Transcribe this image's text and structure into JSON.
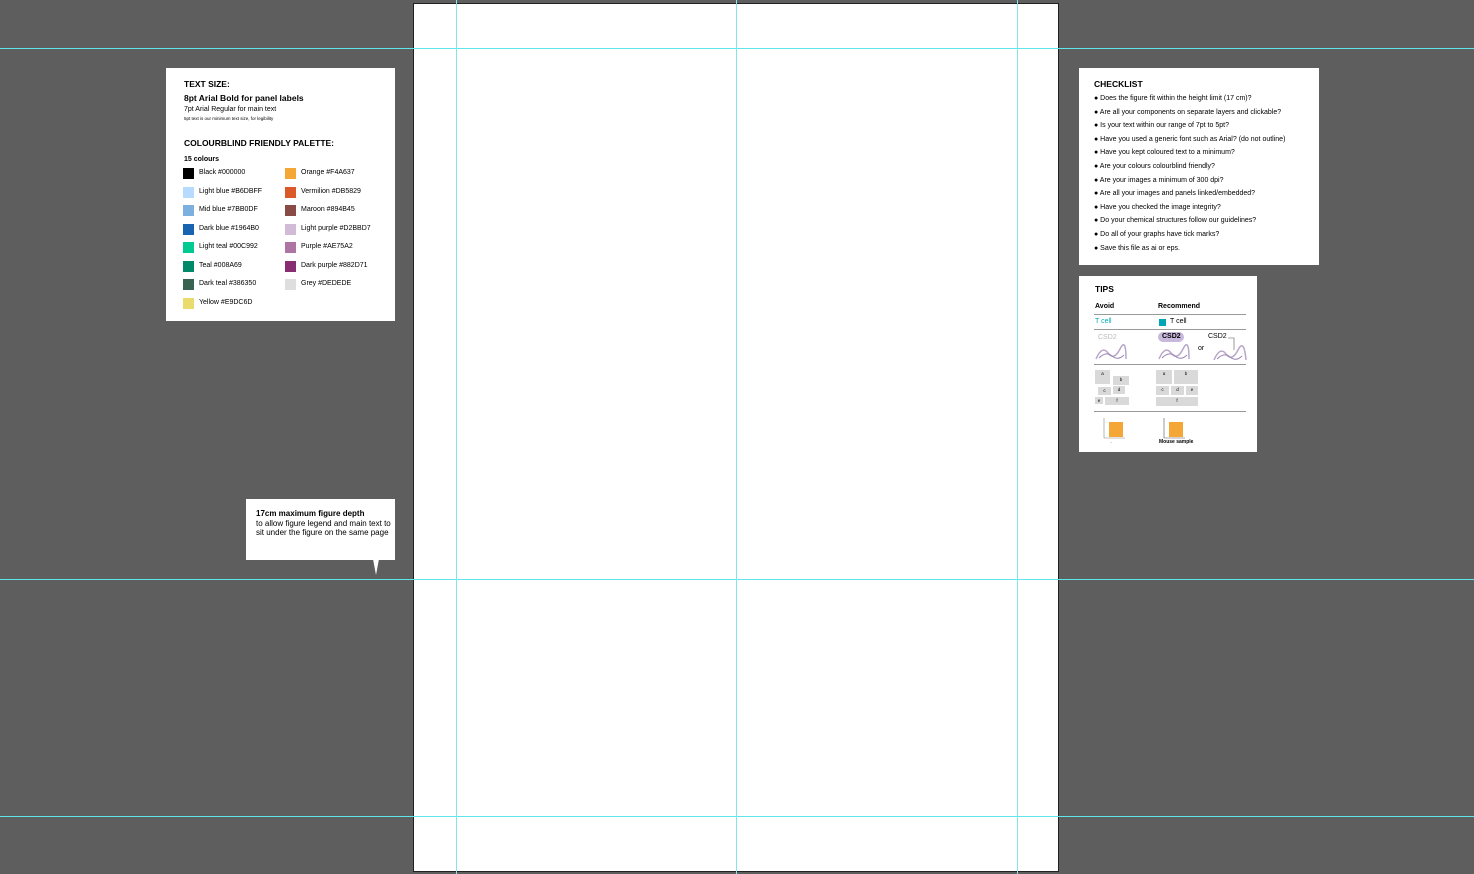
{
  "text_panel": {
    "title": "TEXT SIZE:",
    "line1": "8pt Arial Bold for panel labels",
    "line2": "7pt Arial Regular for main text",
    "line3": "5pt text is our minimum text size, for legibility",
    "palette_title": "COLOURBLIND FRIENDLY PALETTE:",
    "palette_count": "15 colours",
    "left_colours": [
      {
        "label": "Black #000000",
        "color": "#000000"
      },
      {
        "label": "Light blue #B6DBFF",
        "color": "#B6DBFF"
      },
      {
        "label": "Mid blue #7BB0DF",
        "color": "#7BB0DF"
      },
      {
        "label": "Dark blue #1964B0",
        "color": "#1964B0"
      },
      {
        "label": "Light teal #00C992",
        "color": "#00C992"
      },
      {
        "label": "Teal #008A69",
        "color": "#008A69"
      },
      {
        "label": "Dark teal #386350",
        "color": "#386350"
      },
      {
        "label": "Yellow #E9DC6D",
        "color": "#E9DC6D"
      }
    ],
    "right_colours": [
      {
        "label": "Orange #F4A637",
        "color": "#F4A637"
      },
      {
        "label": "Vermilion #DB5829",
        "color": "#DB5829"
      },
      {
        "label": "Maroon #894B45",
        "color": "#894B45"
      },
      {
        "label": "Light purple #D2BBD7",
        "color": "#D2BBD7"
      },
      {
        "label": "Purple #AE75A2",
        "color": "#AE75A2"
      },
      {
        "label": "Dark purple #882D71",
        "color": "#882D71"
      },
      {
        "label": "Grey #DEDEDE",
        "color": "#DEDEDE"
      }
    ]
  },
  "checklist": {
    "title": "CHECKLIST",
    "items": [
      "Does the figure fit within the height limit (17 cm)?",
      "Are all your components on separate layers and clickable?",
      "Is your text within our range of 7pt to 5pt?",
      "Have you used a generic font such as Arial? (do not outline)",
      "Have you kept coloured text to a minimum?",
      "Are your colours colourblind friendly?",
      "Are your images a minimum of 300 dpi?",
      "Are all your images and panels linked/embedded?",
      "Have you checked the image integrity?",
      "Do your chemical structures follow our guidelines?",
      "Do all of your graphs have tick marks?",
      "Save this file as ai or eps."
    ]
  },
  "tips": {
    "title": "TIPS",
    "avoid_label": "Avoid",
    "recommend_label": "Recommend",
    "avoid_tcell": "T cell",
    "recommend_tcell": "T cell",
    "avoid_csd2": "CSD2",
    "recommend_csd2": "CSD2",
    "recommend_csd2_alt": "CSD2",
    "or_label": "or",
    "avoid_panels": [
      "a",
      "b",
      "c",
      "d",
      "e",
      "f"
    ],
    "recommend_panels": [
      "a",
      "b",
      "c",
      "d",
      "e",
      "f"
    ],
    "mouse_sample": "Mouse sample",
    "teal_color": "#00A6B4",
    "bar_color": "#F4A637"
  },
  "callout": {
    "bold": "17cm maximum figure depth",
    "text": "to allow figure legend and main text to sit under the figure on the same page"
  }
}
